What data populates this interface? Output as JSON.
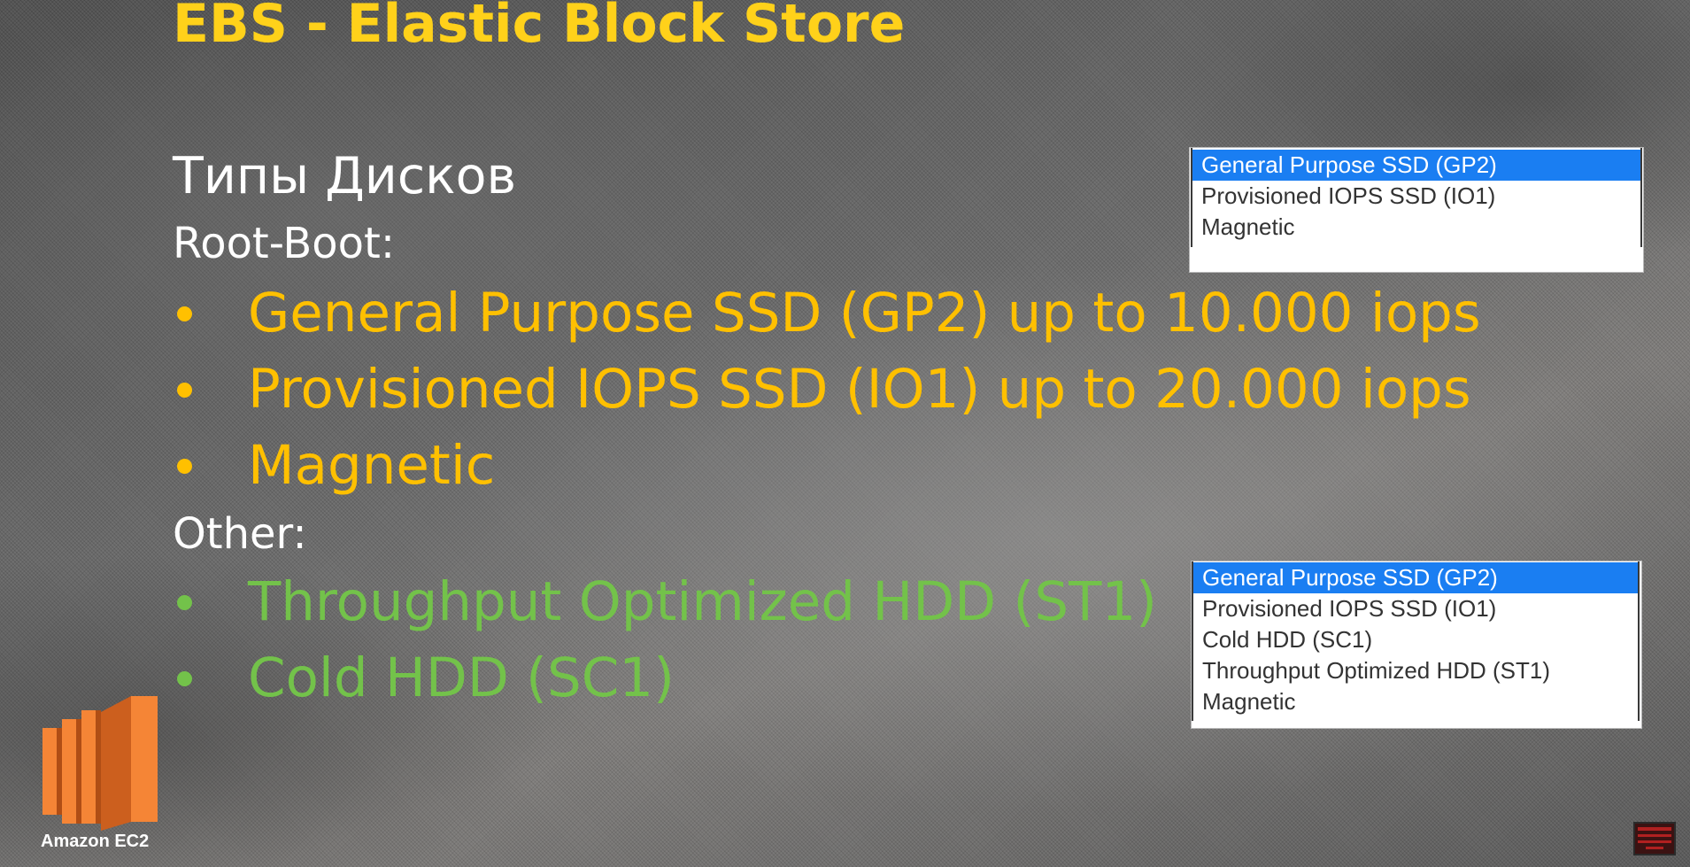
{
  "slide": {
    "title": "EBS - Elastic Block Store",
    "subtitle": "Типы Дисков",
    "root_label": "Root-Boot:",
    "root_items": [
      "General Purpose SSD (GP2) up to 10.000 iops",
      "Provisioned IOPS SSD (IO1) up to 20.000 iops",
      "Magnetic"
    ],
    "other_label": "Other:",
    "other_items": [
      "Throughput Optimized HDD (ST1)",
      "Cold HDD (SC1)"
    ]
  },
  "dropdown_root": {
    "options": [
      "General Purpose SSD (GP2)",
      "Provisioned IOPS SSD (IO1)",
      "Magnetic"
    ],
    "selected": "General Purpose SSD (GP2)"
  },
  "dropdown_other": {
    "options": [
      "General Purpose SSD (GP2)",
      "Provisioned IOPS SSD (IO1)",
      "Cold HDD (SC1)",
      "Throughput Optimized HDD (ST1)",
      "Magnetic"
    ],
    "selected": "General Purpose SSD (GP2)"
  },
  "logo": {
    "label": "Amazon EC2",
    "icon": "aws-ec2-icon",
    "color": "#f58536"
  },
  "colors": {
    "title": "#ffd11a",
    "root_items": "#ffc000",
    "other_items": "#73c24a",
    "selected_option": "#1a7ef2"
  }
}
